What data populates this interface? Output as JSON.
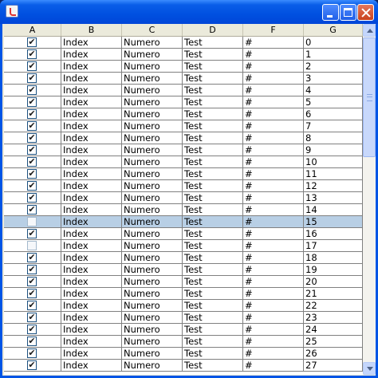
{
  "titlebar": {
    "icons": {
      "app": "java-app-icon",
      "minimize": "minimize-icon",
      "maximize": "maximize-icon",
      "close": "close-icon"
    }
  },
  "table": {
    "columns": [
      "A",
      "B",
      "C",
      "D",
      "F",
      "G"
    ],
    "rows": [
      {
        "checked": true,
        "b": "Index",
        "c": "Numero",
        "d": "Test",
        "f": "#",
        "g": "0"
      },
      {
        "checked": true,
        "b": "Index",
        "c": "Numero",
        "d": "Test",
        "f": "#",
        "g": "1"
      },
      {
        "checked": true,
        "b": "Index",
        "c": "Numero",
        "d": "Test",
        "f": "#",
        "g": "2"
      },
      {
        "checked": true,
        "b": "Index",
        "c": "Numero",
        "d": "Test",
        "f": "#",
        "g": "3"
      },
      {
        "checked": true,
        "b": "Index",
        "c": "Numero",
        "d": "Test",
        "f": "#",
        "g": "4"
      },
      {
        "checked": true,
        "b": "Index",
        "c": "Numero",
        "d": "Test",
        "f": "#",
        "g": "5"
      },
      {
        "checked": true,
        "b": "Index",
        "c": "Numero",
        "d": "Test",
        "f": "#",
        "g": "6"
      },
      {
        "checked": true,
        "b": "Index",
        "c": "Numero",
        "d": "Test",
        "f": "#",
        "g": "7"
      },
      {
        "checked": true,
        "b": "Index",
        "c": "Numero",
        "d": "Test",
        "f": "#",
        "g": "8"
      },
      {
        "checked": true,
        "b": "Index",
        "c": "Numero",
        "d": "Test",
        "f": "#",
        "g": "9"
      },
      {
        "checked": true,
        "b": "Index",
        "c": "Numero",
        "d": "Test",
        "f": "#",
        "g": "10"
      },
      {
        "checked": true,
        "b": "Index",
        "c": "Numero",
        "d": "Test",
        "f": "#",
        "g": "11"
      },
      {
        "checked": true,
        "b": "Index",
        "c": "Numero",
        "d": "Test",
        "f": "#",
        "g": "12"
      },
      {
        "checked": true,
        "b": "Index",
        "c": "Numero",
        "d": "Test",
        "f": "#",
        "g": "13"
      },
      {
        "checked": true,
        "b": "Index",
        "c": "Numero",
        "d": "Test",
        "f": "#",
        "g": "14"
      },
      {
        "checked": false,
        "b": "Index",
        "c": "Numero",
        "d": "Test",
        "f": "#",
        "g": "15",
        "selected": true
      },
      {
        "checked": true,
        "b": "Index",
        "c": "Numero",
        "d": "Test",
        "f": "#",
        "g": "16"
      },
      {
        "checked": false,
        "b": "Index",
        "c": "Numero",
        "d": "Test",
        "f": "#",
        "g": "17"
      },
      {
        "checked": true,
        "b": "Index",
        "c": "Numero",
        "d": "Test",
        "f": "#",
        "g": "18"
      },
      {
        "checked": true,
        "b": "Index",
        "c": "Numero",
        "d": "Test",
        "f": "#",
        "g": "19"
      },
      {
        "checked": true,
        "b": "Index",
        "c": "Numero",
        "d": "Test",
        "f": "#",
        "g": "20"
      },
      {
        "checked": true,
        "b": "Index",
        "c": "Numero",
        "d": "Test",
        "f": "#",
        "g": "21"
      },
      {
        "checked": true,
        "b": "Index",
        "c": "Numero",
        "d": "Test",
        "f": "#",
        "g": "22"
      },
      {
        "checked": true,
        "b": "Index",
        "c": "Numero",
        "d": "Test",
        "f": "#",
        "g": "23"
      },
      {
        "checked": true,
        "b": "Index",
        "c": "Numero",
        "d": "Test",
        "f": "#",
        "g": "24"
      },
      {
        "checked": true,
        "b": "Index",
        "c": "Numero",
        "d": "Test",
        "f": "#",
        "g": "25"
      },
      {
        "checked": true,
        "b": "Index",
        "c": "Numero",
        "d": "Test",
        "f": "#",
        "g": "26"
      },
      {
        "checked": true,
        "b": "Index",
        "c": "Numero",
        "d": "Test",
        "f": "#",
        "g": "27"
      }
    ],
    "check_glyph": "✔"
  },
  "scrollbar": {
    "icons": {
      "up": "scroll-up-arrow-icon",
      "down": "scroll-down-arrow-icon"
    }
  },
  "colors": {
    "titlebar": "#0055e5",
    "selected_row": "#b8cfe5",
    "header_bg": "#ebeadb",
    "grid": "#808080"
  }
}
